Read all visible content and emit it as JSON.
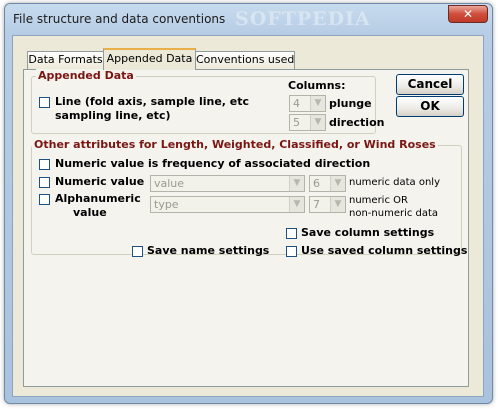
{
  "window": {
    "title": "File structure and data conventions",
    "watermark": "SOFTPEDIA",
    "close_glyph": "✕"
  },
  "tabs": [
    {
      "label": "Data Formats"
    },
    {
      "label": "Appended Data"
    },
    {
      "label": "Conventions used"
    }
  ],
  "buttons": {
    "cancel": "Cancel",
    "ok": "OK"
  },
  "appended": {
    "legend": "Appended Data",
    "line_label_1": "Line (fold axis, sample line, etc",
    "line_label_2": "sampling line, etc)",
    "columns_label": "Columns:",
    "plunge_value": "4",
    "plunge_label": "plunge",
    "direction_value": "5",
    "direction_label": "direction"
  },
  "other": {
    "legend": "Other attributes for Length, Weighted, Classified, or Wind Roses",
    "freq_label": "Numeric value is frequency of associated direction",
    "numeric_label": "Numeric value",
    "numeric_combo": "value",
    "numeric_col": "6",
    "numeric_note": "numeric data only",
    "alpha_label_1": "Alphanumeric",
    "alpha_label_2": "value",
    "alpha_combo": "type",
    "alpha_col": "7",
    "alpha_note_1": "numeric OR",
    "alpha_note_2": "non-numeric data"
  },
  "settings": {
    "save_column": "Save column settings",
    "save_name": "Save name settings",
    "use_saved": "Use saved column settings"
  }
}
